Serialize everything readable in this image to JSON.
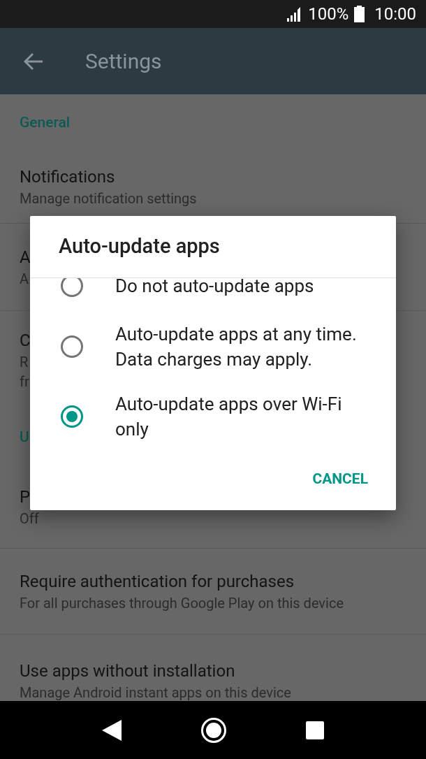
{
  "status_bar": {
    "battery": "100%",
    "time": "10:00"
  },
  "app_bar": {
    "title": "Settings"
  },
  "settings": [
    {
      "kind": "header",
      "title": "General"
    },
    {
      "kind": "item",
      "title": "Notifications",
      "summary": [
        "Manage notification settings"
      ]
    },
    {
      "kind": "item",
      "title": "A",
      "summary": [
        "A"
      ]
    },
    {
      "kind": "item",
      "title": "C",
      "summary": [
        "R",
        "fr"
      ]
    },
    {
      "kind": "header",
      "title": "U"
    },
    {
      "kind": "item",
      "title": "P",
      "summary": [
        "Off"
      ]
    },
    {
      "kind": "item",
      "title": "Require authentication for purchases",
      "summary": [
        "For all purchases through Google Play on this device"
      ]
    },
    {
      "kind": "item",
      "title": "Use apps without installation",
      "summary": [
        "Manage Android instant apps on this device"
      ]
    }
  ],
  "dialog": {
    "title": "Auto-update apps",
    "options": [
      {
        "label": "Do not auto-update apps",
        "selected": false
      },
      {
        "label": "Auto-update apps at any time. Data charges may apply.",
        "selected": false
      },
      {
        "label": "Auto-update apps over Wi-Fi only",
        "selected": true
      }
    ],
    "buttons": [
      "CANCEL"
    ]
  }
}
